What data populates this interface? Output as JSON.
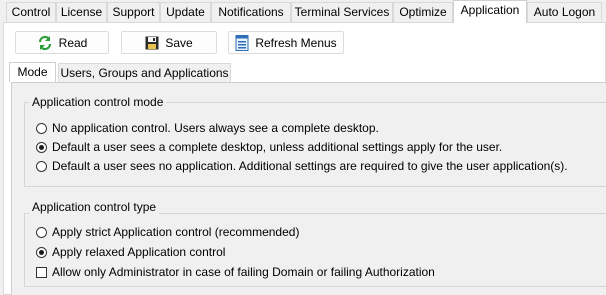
{
  "tabs": [
    "Control",
    "License",
    "Support",
    "Update",
    "Notifications",
    "Terminal Services",
    "Optimize",
    "Application",
    "Auto Logon"
  ],
  "active_tab": "Application",
  "toolbar": {
    "read_label": "Read",
    "save_label": "Save",
    "refresh_label": "Refresh Menus"
  },
  "subtabs": [
    "Mode",
    "Users, Groups and Applications"
  ],
  "mode_group": {
    "title": "Application control mode",
    "options": [
      {
        "label": "No application control. Users always see a complete desktop.",
        "selected": false
      },
      {
        "label": "Default a user sees a complete desktop, unless additional settings apply for the user.",
        "selected": true
      },
      {
        "label": "Default a user sees no application. Additional settings are required to give the user application(s).",
        "selected": false
      }
    ]
  },
  "type_group": {
    "title": "Application control type",
    "options": [
      {
        "label": "Apply strict Application control (recommended)",
        "selected": false
      },
      {
        "label": "Apply relaxed Application control",
        "selected": true
      }
    ],
    "checkbox": {
      "label": "Allow only Administrator in case of failing Domain or failing Authorization",
      "checked": false
    }
  }
}
